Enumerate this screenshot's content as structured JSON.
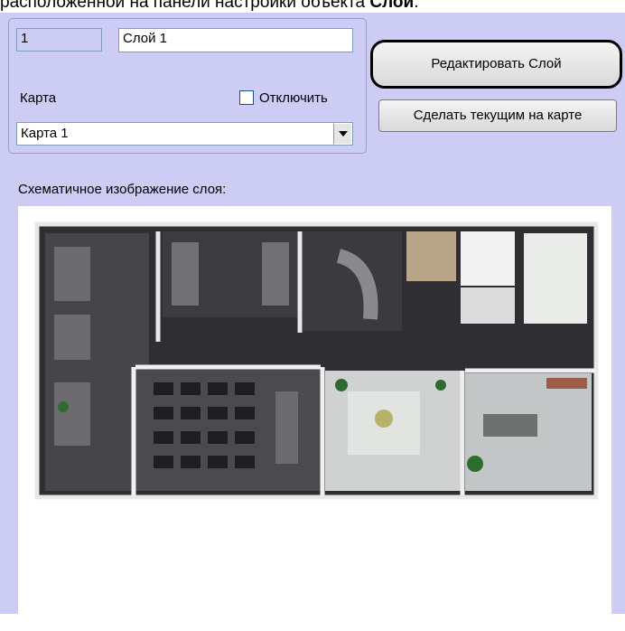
{
  "caption": {
    "prefix": "расположенной на панели настройки объекта ",
    "object": "Слой",
    "suffix": "."
  },
  "layer": {
    "id_value": "1",
    "name_value": "Слой 1",
    "map_label": "Карта",
    "disable_label": "Отключить",
    "disable_checked": false,
    "map_selected": "Карта 1"
  },
  "buttons": {
    "edit_layer": "Редактировать Слой",
    "make_current": "Сделать текущим на карте"
  },
  "schematic_label": "Схематичное изображение слоя:",
  "colors": {
    "panel_bg": "#ccccf5",
    "floor": "#2f2f33"
  }
}
